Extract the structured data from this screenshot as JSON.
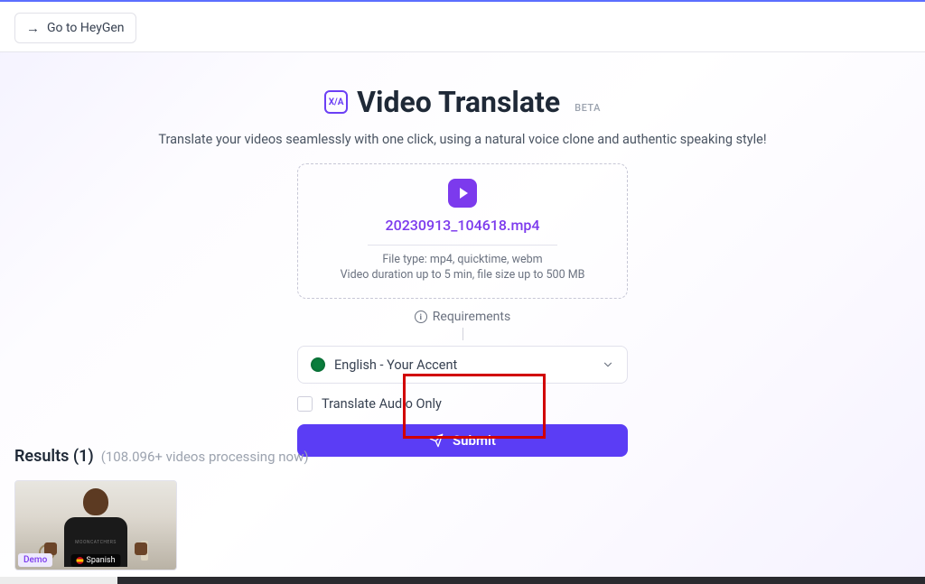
{
  "header": {
    "go_label": "Go to HeyGen"
  },
  "hero": {
    "title": "Video Translate",
    "badge": "BETA",
    "icon_tag": "X/A",
    "subtitle": "Translate your videos seamlessly with one click, using a natural voice clone and authentic speaking style!"
  },
  "upload": {
    "filename": "20230913_104618.mp4",
    "hint_filetype": "File type: mp4, quicktime, webm",
    "hint_limits": "Video duration up to 5 min, file size up to 500 MB",
    "requirements_label": "Requirements"
  },
  "language": {
    "selected": "English - Your Accent"
  },
  "options": {
    "audio_only_label": "Translate Audio Only"
  },
  "actions": {
    "submit_label": "Submit"
  },
  "results": {
    "title": "Results (1)",
    "processing_text": "(108.096+ videos processing now)",
    "items": [
      {
        "tag": "Demo",
        "language": "Spanish",
        "shirt": "MOONCATCHERS"
      }
    ]
  }
}
